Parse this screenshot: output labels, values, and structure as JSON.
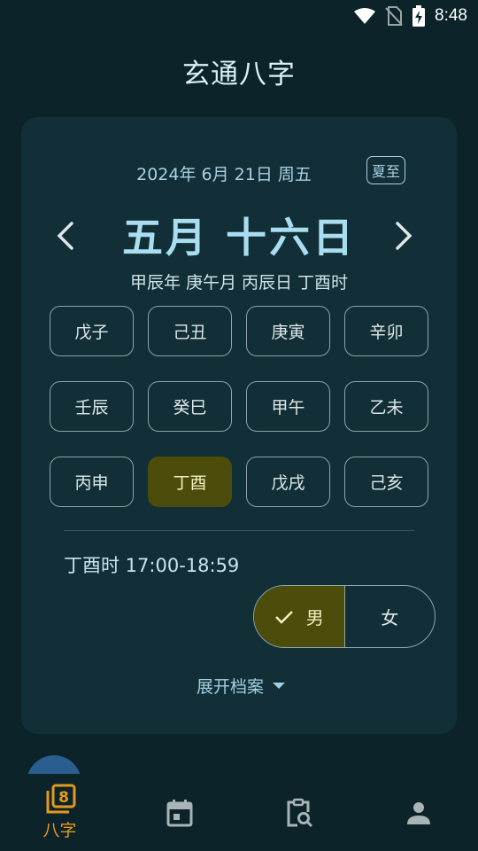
{
  "status_bar": {
    "time": "8:48",
    "icons": [
      "wifi-icon",
      "no-sim-icon",
      "battery-charging-icon"
    ]
  },
  "app_title": "玄通八字",
  "date_card": {
    "solar_date": "2024年 6月 21日 周五",
    "solar_term": "夏至",
    "lunar_date": "五月 十六日",
    "ganzhi": "甲辰年 庚午月 丙辰日 丁酉时",
    "prev_icon": "chevron-left-icon",
    "next_icon": "chevron-right-icon"
  },
  "hours": [
    {
      "label": "戊子",
      "selected": false
    },
    {
      "label": "己丑",
      "selected": false
    },
    {
      "label": "庚寅",
      "selected": false
    },
    {
      "label": "辛卯",
      "selected": false
    },
    {
      "label": "壬辰",
      "selected": false
    },
    {
      "label": "癸巳",
      "selected": false
    },
    {
      "label": "甲午",
      "selected": false
    },
    {
      "label": "乙未",
      "selected": false
    },
    {
      "label": "丙申",
      "selected": false
    },
    {
      "label": "丁酉",
      "selected": true
    },
    {
      "label": "戊戌",
      "selected": false
    },
    {
      "label": "己亥",
      "selected": false
    }
  ],
  "selected_hour_range": "丁酉时 17:00-18:59",
  "gender": {
    "male": "男",
    "female": "女",
    "selected": "male"
  },
  "expand_label": "展开档案",
  "bottom_nav": [
    {
      "label": "八字",
      "icon": "bazi-tab-icon",
      "active": true
    },
    {
      "label": "",
      "icon": "calendar-icon",
      "active": false
    },
    {
      "label": "",
      "icon": "clipboard-search-icon",
      "active": false
    },
    {
      "label": "",
      "icon": "person-icon",
      "active": false
    }
  ],
  "colors": {
    "background": "#0b2329",
    "card": "#122e36",
    "selected": "#4c4d0a",
    "accent": "#e39a1e",
    "text_blue": "#a9ddf0"
  }
}
